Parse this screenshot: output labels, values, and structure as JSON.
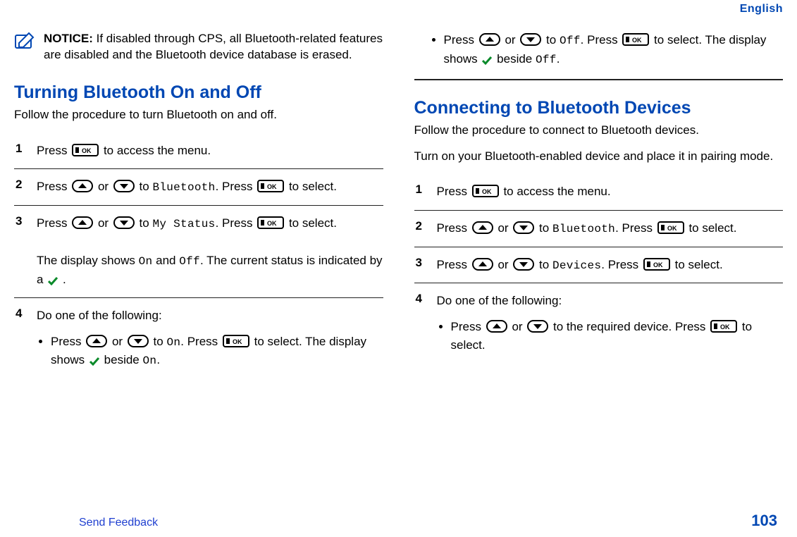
{
  "header": {
    "lang": "English"
  },
  "notice": {
    "title": "NOTICE:",
    "body": "If disabled through CPS, all Bluetooth-related features are disabled and the Bluetooth device database is erased."
  },
  "section1": {
    "heading": "Turning Bluetooth On and Off",
    "intro": "Follow the procedure to turn Bluetooth on and off.",
    "step1_a": "Press",
    "step1_b": "to access the menu.",
    "step2_a": "Press",
    "step2_b": "or",
    "step2_c": "to",
    "step2_item": "Bluetooth",
    "step2_d": ". Press",
    "step2_e": "to select.",
    "step3_a": "Press",
    "step3_b": "or",
    "step3_c": "to",
    "step3_item": "My Status",
    "step3_d": ". Press",
    "step3_e": "to select.",
    "step3_note_a": "The display shows",
    "step3_on": "On",
    "step3_note_b": "and",
    "step3_off": "Off",
    "step3_note_c": ". The current status is indicated by a",
    "step3_note_d": ".",
    "step4_lead": "Do one of the following:",
    "step4_b1_a": "Press",
    "step4_b1_b": "or",
    "step4_b1_c": "to",
    "step4_b1_item": "On",
    "step4_b1_d": ". Press",
    "step4_b1_e": "to select. The display shows",
    "step4_b1_f": "beside",
    "step4_b1_item2": "On",
    "step4_b1_g": ".",
    "step4_b2_a": "Press",
    "step4_b2_b": "or",
    "step4_b2_c": "to",
    "step4_b2_item": "Off",
    "step4_b2_d": ". Press",
    "step4_b2_e": "to select. The display shows",
    "step4_b2_f": "beside",
    "step4_b2_item2": "Off",
    "step4_b2_g": "."
  },
  "section2": {
    "heading": "Connecting to Bluetooth Devices",
    "intro1": "Follow the procedure to connect to Bluetooth devices.",
    "intro2": "Turn on your Bluetooth-enabled device and place it in pairing mode.",
    "step1_a": "Press",
    "step1_b": "to access the menu.",
    "step2_a": "Press",
    "step2_b": "or",
    "step2_c": "to",
    "step2_item": "Bluetooth",
    "step2_d": ". Press",
    "step2_e": "to select.",
    "step3_a": "Press",
    "step3_b": "or",
    "step3_c": "to",
    "step3_item": "Devices",
    "step3_d": ". Press",
    "step3_e": "to select.",
    "step4_lead": "Do one of the following:",
    "step4_b1_a": "Press",
    "step4_b1_b": "or",
    "step4_b1_c": "to the required device. Press",
    "step4_b1_d": "to select."
  },
  "footer": {
    "feedback": "Send Feedback",
    "page": "103"
  },
  "nums": {
    "n1": "1",
    "n2": "2",
    "n3": "3",
    "n4": "4"
  }
}
